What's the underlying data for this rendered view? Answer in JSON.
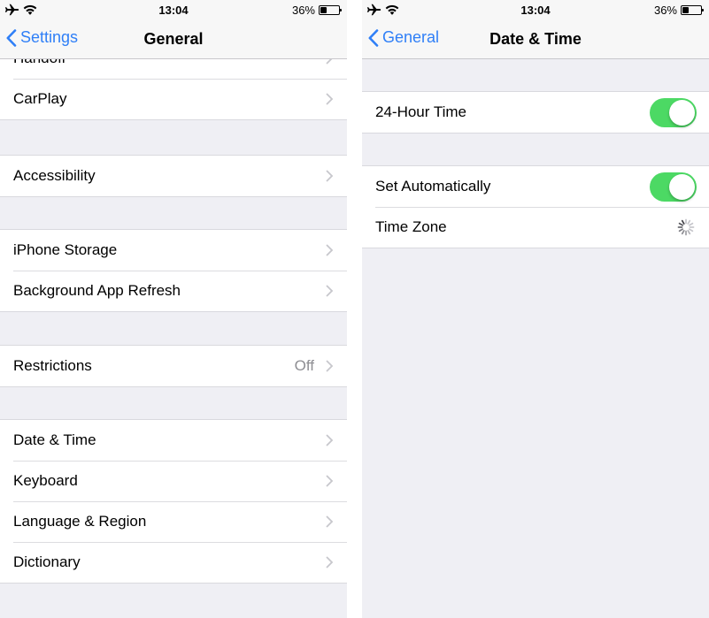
{
  "status_bar": {
    "time": "13:04",
    "battery": "36%",
    "battery_level": 0.36
  },
  "left_screen": {
    "back_label": "Settings",
    "title": "General",
    "rows": [
      {
        "label": "Handoff"
      },
      {
        "label": "CarPlay"
      },
      {
        "label": "Accessibility"
      },
      {
        "label": "iPhone Storage"
      },
      {
        "label": "Background App Refresh"
      },
      {
        "label": "Restrictions",
        "detail": "Off"
      },
      {
        "label": "Date & Time"
      },
      {
        "label": "Keyboard"
      },
      {
        "label": "Language & Region"
      },
      {
        "label": "Dictionary"
      }
    ]
  },
  "right_screen": {
    "back_label": "General",
    "title": "Date & Time",
    "rows": [
      {
        "label": "24-Hour Time",
        "toggle": true
      },
      {
        "label": "Set Automatically",
        "toggle": true
      },
      {
        "label": "Time Zone",
        "loading": true
      }
    ]
  },
  "colors": {
    "accent": "#2f7ff7",
    "toggle_on": "#4cd964",
    "background": "#efeff4",
    "detail_text": "#8e8e93"
  }
}
